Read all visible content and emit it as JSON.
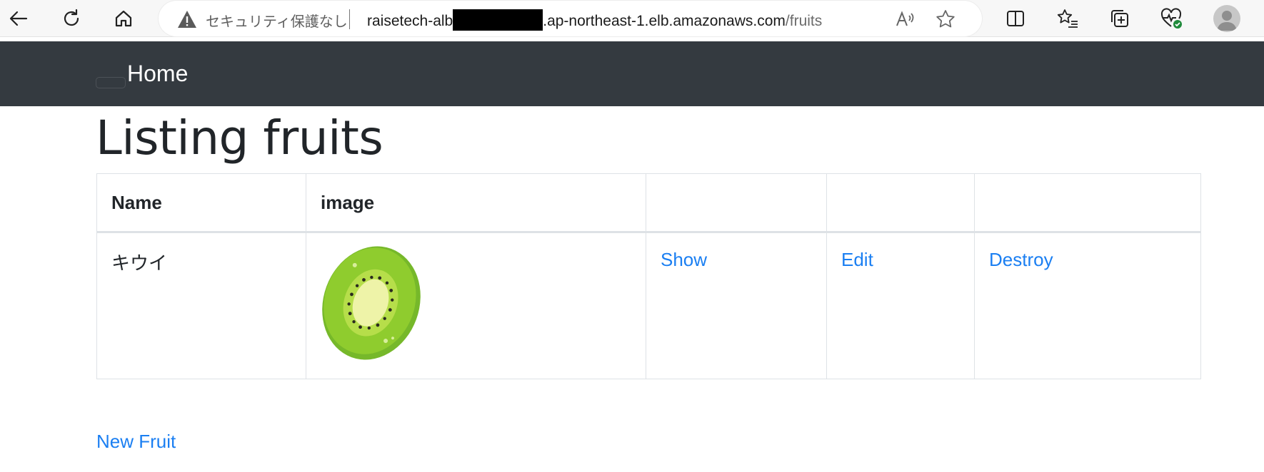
{
  "browser": {
    "security_label": "セキュリティ保護なし",
    "url_prefix": "raisetech-alb",
    "url_host_suffix": ".ap-northeast-1.elb.amazonaws.com",
    "url_path": "/fruits",
    "toolbar_icons": [
      "back-icon",
      "refresh-icon",
      "home-icon",
      "read-aloud-icon",
      "favorite-star-icon",
      "split-screen-icon",
      "favorites-icon",
      "collections-icon",
      "browser-essentials-icon",
      "profile-avatar"
    ]
  },
  "navbar": {
    "home_label": "Home"
  },
  "page": {
    "title": "Listing fruits",
    "new_link": "New Fruit"
  },
  "table": {
    "headers": [
      "Name",
      "image",
      "",
      "",
      ""
    ],
    "rows": [
      {
        "name": "キウイ",
        "image": "kiwi-image",
        "show": "Show",
        "edit": "Edit",
        "destroy": "Destroy"
      }
    ]
  },
  "colors": {
    "navbar_bg": "#343a40",
    "link": "#1b7ff2",
    "text": "#212529"
  }
}
